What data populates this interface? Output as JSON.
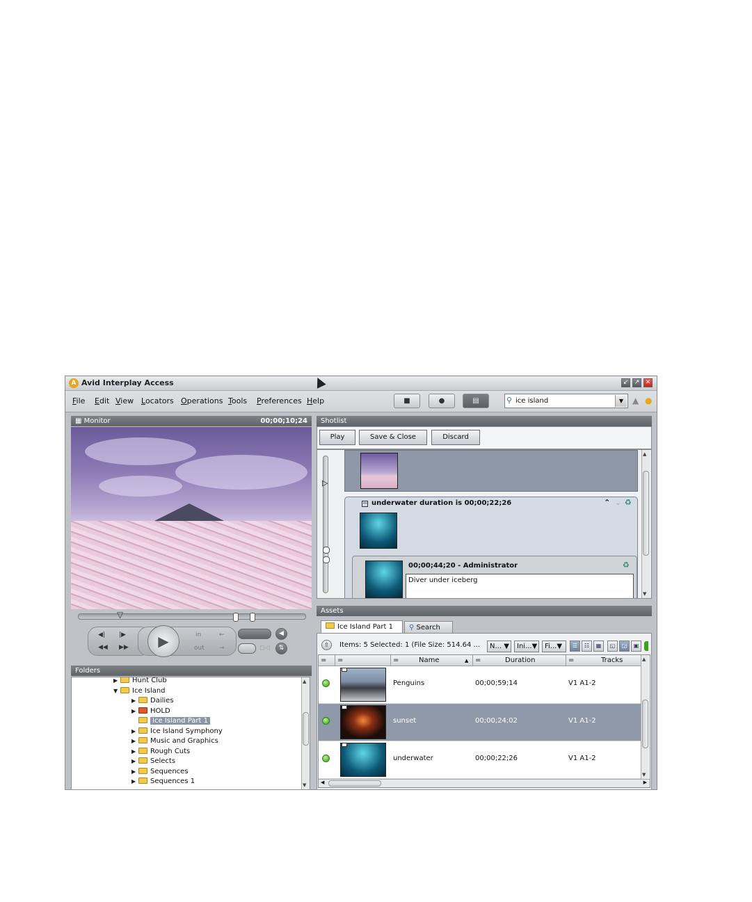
{
  "window": {
    "title": "Avid Interplay Access",
    "logo": "A"
  },
  "menu": [
    "File",
    "Edit",
    "View",
    "Locators",
    "Operations",
    "Tools",
    "Preferences",
    "Help"
  ],
  "search": {
    "value": "ice island"
  },
  "monitor": {
    "title": "Monitor",
    "timecode": "00;00;10;24",
    "in_label": "in",
    "out_label": "out"
  },
  "shotlist": {
    "title": "Shotlist",
    "buttons": [
      "Play",
      "Save & Close",
      "Discard"
    ],
    "group_title": "underwater duration is 00;00;22;26",
    "locator_title": "00;00;44;20 - Administrator",
    "locator_comment": "Diver under iceberg"
  },
  "folders": {
    "title": "Folders",
    "items": [
      {
        "label": "Hunt Club",
        "level": 1,
        "arrow": "▶"
      },
      {
        "label": "Ice Island",
        "level": 1,
        "arrow": "▼"
      },
      {
        "label": "Dailies",
        "level": 2,
        "arrow": "▶"
      },
      {
        "label": "HOLD",
        "level": 2,
        "arrow": "▶"
      },
      {
        "label": "Ice Island Part 1",
        "level": 2,
        "arrow": ""
      },
      {
        "label": "Ice Island Symphony",
        "level": 2,
        "arrow": "▶"
      },
      {
        "label": "Music and Graphics",
        "level": 2,
        "arrow": "▶"
      },
      {
        "label": "Rough Cuts",
        "level": 2,
        "arrow": "▶"
      },
      {
        "label": "Selects",
        "level": 2,
        "arrow": "▶"
      },
      {
        "label": "Sequences",
        "level": 2,
        "arrow": "▶"
      },
      {
        "label": "Sequences 1",
        "level": 2,
        "arrow": "▶"
      }
    ]
  },
  "assets": {
    "title": "Assets",
    "tabs": [
      "Ice Island Part 1",
      "Search"
    ],
    "items_info": "Items: 5 Selected: 1 (File Size: 514.64 ...",
    "filters": [
      "N...",
      "Ini...",
      "Fi..."
    ],
    "columns": [
      "Name",
      "Duration",
      "Tracks"
    ],
    "rows": [
      {
        "name": "Penguins",
        "duration": "00;00;59;14",
        "tracks": "V1 A1-2"
      },
      {
        "name": "sunset",
        "duration": "00;00;24;02",
        "tracks": "V1 A1-2"
      },
      {
        "name": "underwater",
        "duration": "00;00;22;26",
        "tracks": "V1 A1-2"
      }
    ]
  },
  "colors": {
    "panel_header": "#5f6469",
    "selection": "#8f99aa",
    "status_online": "#3aa21c",
    "close_button": "#c0281a"
  }
}
